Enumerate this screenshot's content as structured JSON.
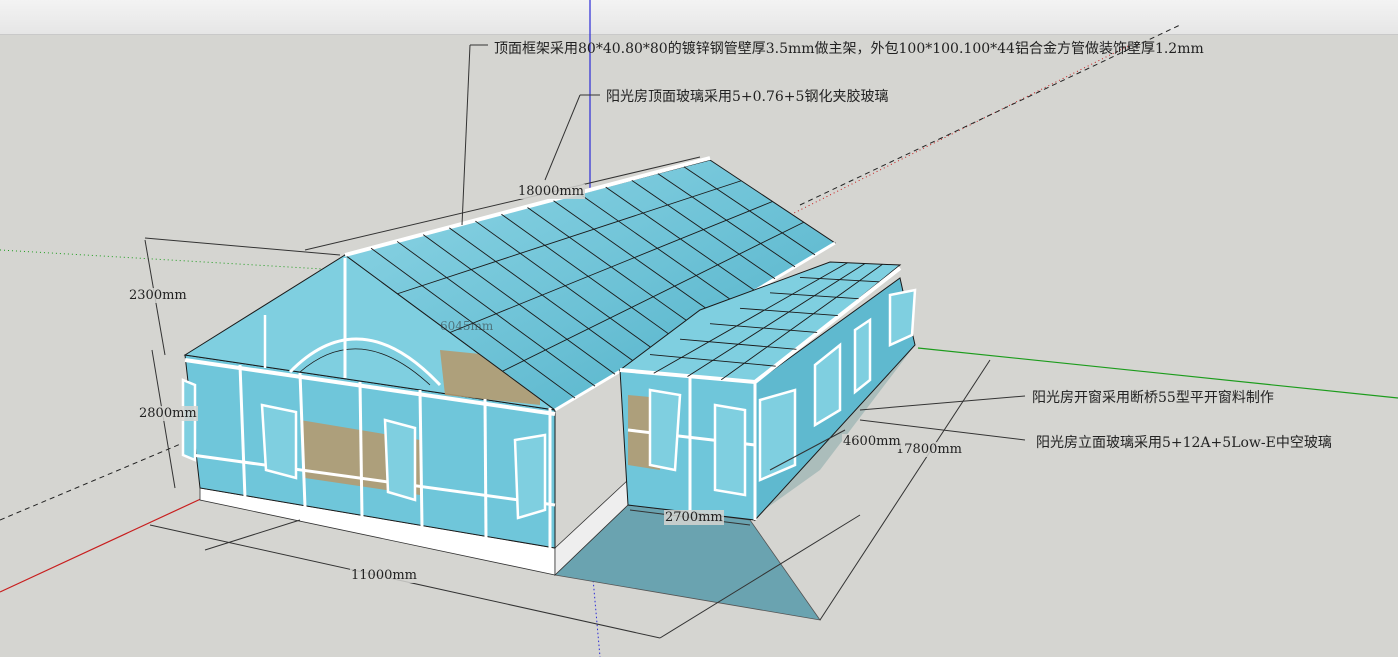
{
  "viewport": {
    "background": "#d5d5d1",
    "axis_colors": {
      "red": "#c81e1e",
      "green": "#1c9c1c",
      "blue": "#2b2bd6"
    }
  },
  "annotations": {
    "roof_frame": "顶面框架采用80*40.80*80的镀锌钢管壁厚3.5mm做主架，外包100*100.100*44铝合金方管做装饰壁厚1.2mm",
    "roof_glass": "阳光房顶面玻璃采用5+0.76+5钢化夹胶玻璃",
    "window": "阳光房开窗采用断桥55型平开窗料制作",
    "facade_glass": "阳光房立面玻璃采用5+12A+5Low-E中空玻璃"
  },
  "dimensions": {
    "roof_length": "18000mm",
    "ridge_height": "2300mm",
    "wall_height": "2800mm",
    "gable_width": "11000mm",
    "side_depth": "17800mm",
    "wing_width": "4600mm",
    "wing_depth": "2700mm",
    "inner_partial": "6045mm"
  },
  "model": {
    "glass_color": "#6fc6da",
    "glass_dark": "#3f9db5",
    "frame_color": "#ffffff",
    "outline_color": "#1a1a1a",
    "floor_color": "#6aa3b0",
    "wood_color": "#b49a70"
  }
}
